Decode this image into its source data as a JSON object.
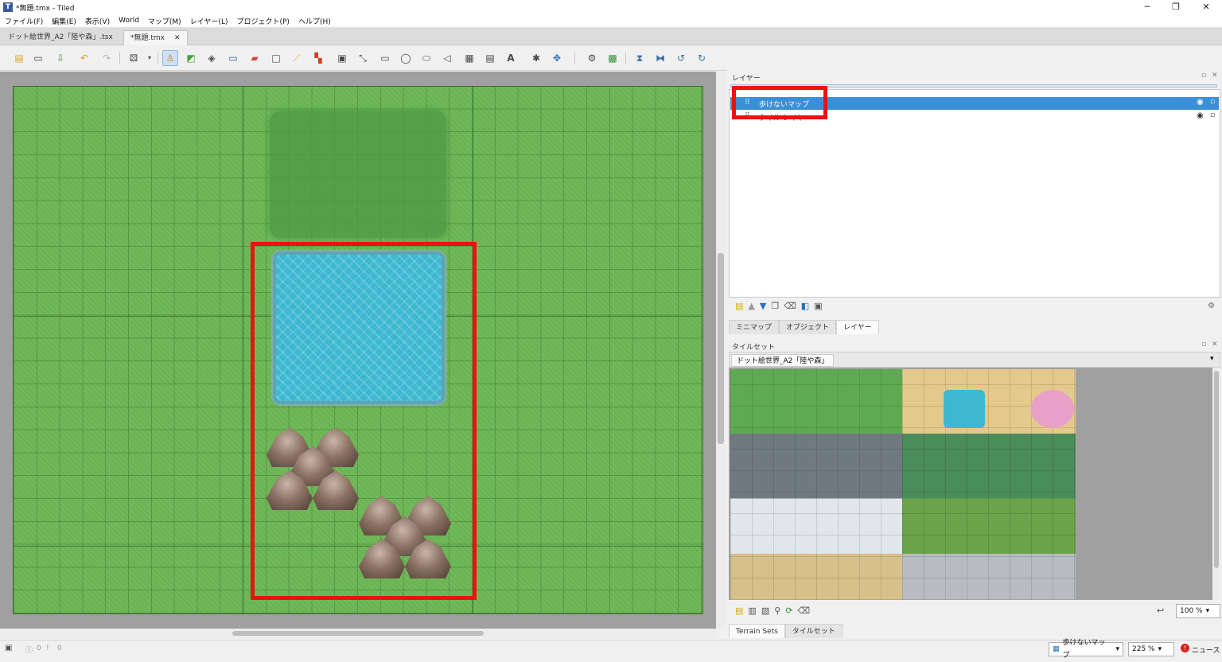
{
  "window": {
    "title": "*無題.tmx - Tiled",
    "app_icon": "T"
  },
  "window_controls": {
    "minimize": "─",
    "maximize": "❐",
    "close": "✕"
  },
  "menu": [
    "ファイル(F)",
    "編集(E)",
    "表示(V)",
    "World",
    "マップ(M)",
    "レイヤー(L)",
    "プロジェクト(P)",
    "ヘルプ(H)"
  ],
  "doc_tabs": [
    {
      "label": "ドット絵世界_A2「陸や森」.tsx",
      "close": "✕"
    },
    {
      "label": "*無題.tmx",
      "close": "✕"
    }
  ],
  "layers_panel": {
    "title": "レイヤー",
    "rows": [
      {
        "name": "歩けないマップ",
        "selected": true
      },
      {
        "name": "タイル レイヤー",
        "selected": false
      }
    ]
  },
  "panel_tabs_top": [
    "ミニマップ",
    "オブジェクト",
    "レイヤー"
  ],
  "tileset_panel": {
    "title": "タイルセット",
    "selected_tileset": "ドット絵世界_A2「陸や森」",
    "zoom": "100 %"
  },
  "panel_tabs_bottom": [
    "Terrain Sets",
    "タイルセット"
  ],
  "status": {
    "errors": "0",
    "warnings": "0",
    "layer": "歩けないマップ",
    "zoom": "225 %",
    "news": "ニュース"
  },
  "colors": {
    "grass": "#6ab454",
    "water": "#3db8d0",
    "highlight": "#ee1111",
    "selection": "#3b8fd6"
  }
}
